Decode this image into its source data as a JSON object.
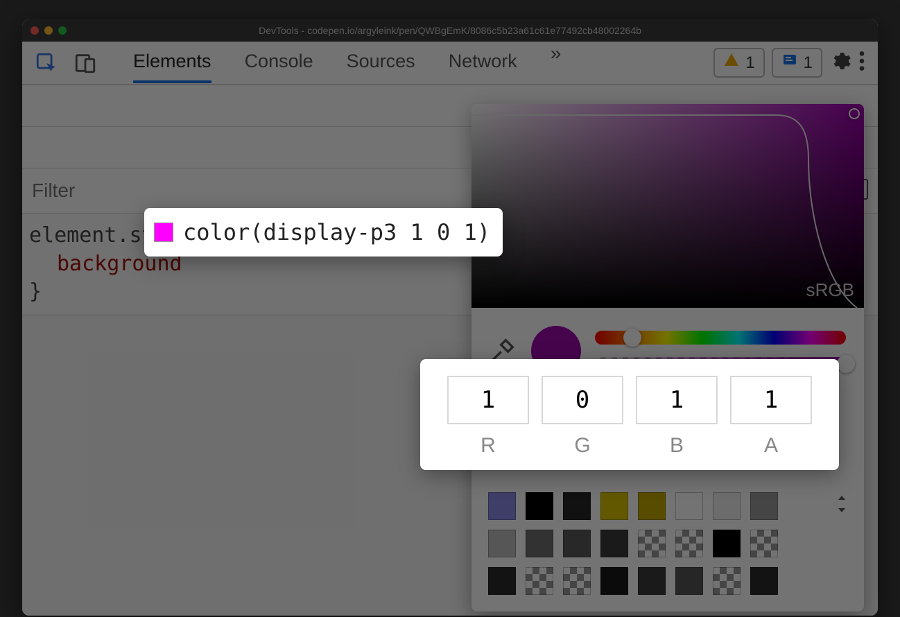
{
  "window": {
    "title": "DevTools - codepen.io/argyleink/pen/QWBgEmK/8086c5b23a61c61e77492cb48002264b"
  },
  "toolbar": {
    "tabs": [
      {
        "label": "Elements",
        "active": true
      },
      {
        "label": "Console",
        "active": false
      },
      {
        "label": "Sources",
        "active": false
      },
      {
        "label": "Network",
        "active": false
      }
    ],
    "more_glyph": "»",
    "warnings_count": "1",
    "issues_count": "1"
  },
  "styles": {
    "filter_placeholder": "Filter",
    "selector": "element.style",
    "open_brace": "{",
    "close_brace": "}",
    "property_name": "background"
  },
  "tooltip": {
    "value_text": "color(display-p3 1 0 1)",
    "swatch_color": "#ff00ff"
  },
  "picker": {
    "gamut_label": "sRGB",
    "hue_thumb_pct": 15,
    "alpha_thumb_pct": 100,
    "current_color": "#9c0aa8",
    "channels": [
      {
        "label": "R",
        "value": "1"
      },
      {
        "label": "G",
        "value": "0"
      },
      {
        "label": "B",
        "value": "1"
      },
      {
        "label": "A",
        "value": "1"
      }
    ],
    "palette": [
      [
        "#8a8ae8",
        "#000000",
        "#262626",
        "#d8c400",
        "#c0a800",
        "#ffffff",
        "#f0f0f0",
        "#9a9a9a"
      ],
      [
        "#bfbfbf",
        "#6f6f6f",
        "#5a5a5a",
        "#3a3a3a",
        "checker",
        "checker",
        "#000000",
        "checker"
      ],
      [
        "#2b2b2b",
        "checker",
        "checker",
        "#1a1a1a",
        "#3a3a3a",
        "#555555",
        "checker",
        "#2b2b2b"
      ]
    ]
  }
}
